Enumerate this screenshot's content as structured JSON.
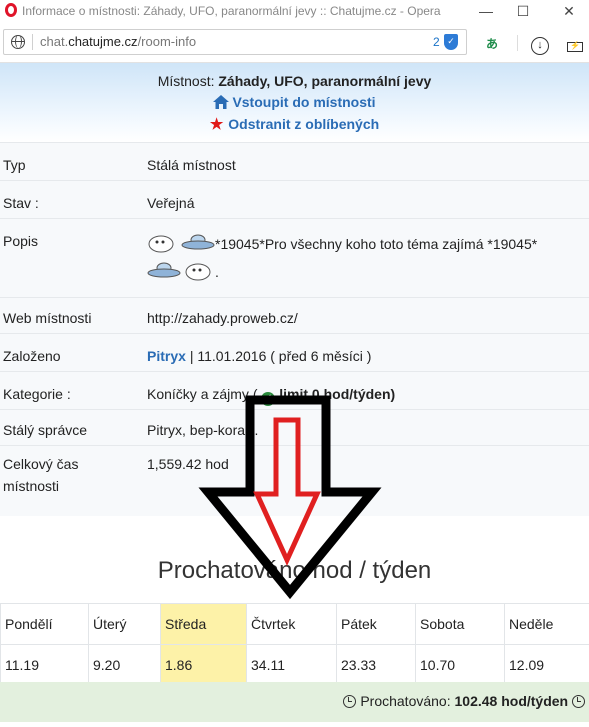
{
  "window": {
    "title": "Informace o místnosti: Záhady, UFO, paranormální jevy :: Chatujme.cz - Opera",
    "minimize": "—",
    "maximize": "☐",
    "close": "✕"
  },
  "addressbar": {
    "url_prefix": "chat.",
    "url_domain": "chatujme.cz",
    "url_path": "/room-info",
    "blocked_count": "2",
    "icons": [
      "globe-icon",
      "shield-icon",
      "translate-icon",
      "download-icon",
      "battery-icon"
    ]
  },
  "header": {
    "room_label": "Místnost:",
    "room_name": "Záhady, UFO, paranormální jevy",
    "enter_link": "Vstoupit do místnosti",
    "remove_fav_link": "Odstranit z oblíbených"
  },
  "info": {
    "type_label": "Typ",
    "type_value": "Stálá místnost",
    "state_label": "Stav :",
    "state_value": "Veřejná",
    "desc_label": "Popis",
    "desc_value": "*19045*Pro všechny koho toto téma zajímá *19045*",
    "desc_tail": ".",
    "web_label": "Web místnosti",
    "web_value": "http://zahady.proweb.cz/",
    "founded_label": "Založeno",
    "founded_user": "Pitryx",
    "founded_date": "| 11.01.2016 ( před 6 měsíci )",
    "category_label": "Kategorie :",
    "category_value": "Koníčky a zájmy (",
    "category_limit": "limit 0 hod/týden)",
    "admin_label": "Stálý správce",
    "admin_value": "Pitryx, bep-kora",
    "admin_more": "…",
    "total_label": "Celkový čas místnosti",
    "total_value": "1,559.42 hod"
  },
  "week": {
    "title": "Prochatováno hod / týden",
    "days": [
      "Pondělí",
      "Úterý",
      "Středa",
      "Čtvrtek",
      "Pátek",
      "Sobota",
      "Neděle"
    ],
    "values": [
      "11.19",
      "9.20",
      "1.86",
      "34.11",
      "23.33",
      "10.70",
      "12.09"
    ],
    "highlight_day": "Středa"
  },
  "footer": {
    "label": "Prochatováno:",
    "value": "102.48 hod/týden"
  },
  "colors": {
    "link": "#2a6cb5",
    "highlight": "#fdf2a8",
    "footer_bg": "#e3f0de",
    "arrow_outer": "#000000",
    "arrow_inner": "#e02020"
  }
}
